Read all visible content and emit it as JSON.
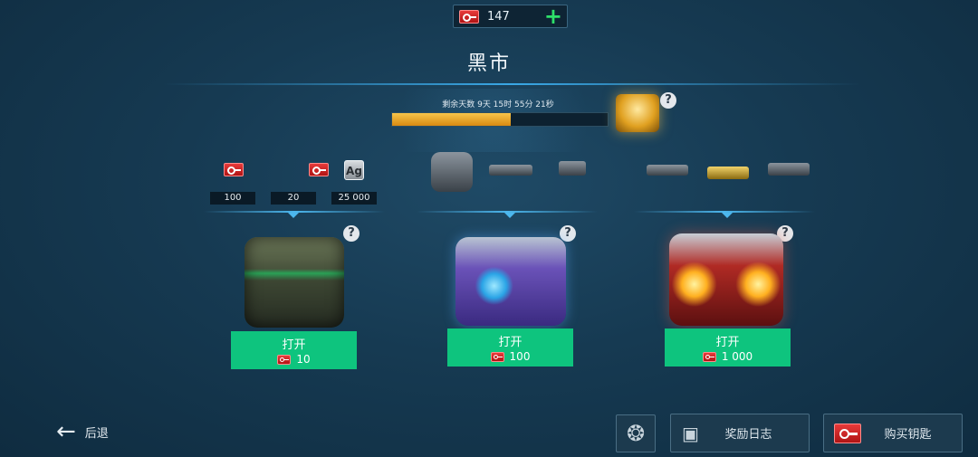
{
  "currency": {
    "keys": "147",
    "add_icon": "plus-icon",
    "color_add": "#2ee06a"
  },
  "title": "黑市",
  "timer": {
    "label": "剩余天数 9天 15时 55分 21秒",
    "progress": 0.55
  },
  "help_mark": "?",
  "rewards": {
    "group1": [
      {
        "icon": "key-icon",
        "value": "100"
      },
      {
        "icon": "key-icon",
        "value": "20"
      },
      {
        "icon": "silver-icon",
        "label": "Ag",
        "value": "25 000"
      }
    ],
    "group2_icons": [
      "robot-icon",
      "weapon-icon",
      "weapon-icon"
    ],
    "group3_icons": [
      "weapon-icon",
      "weapon-icon",
      "weapon-icon"
    ]
  },
  "chests": [
    {
      "name": "green-chest",
      "open_label": "打开",
      "cost": "10"
    },
    {
      "name": "purple-chest",
      "open_label": "打开",
      "cost": "100"
    },
    {
      "name": "red-chest",
      "open_label": "打开",
      "cost": "1 000"
    }
  ],
  "bottom": {
    "back_label": "后退",
    "log_label": "奖励日志",
    "buy_label": "购买钥匙"
  },
  "colors": {
    "accent_green": "#0ec47e",
    "progress": "#f2b232",
    "glow": "#4cb7ee"
  }
}
